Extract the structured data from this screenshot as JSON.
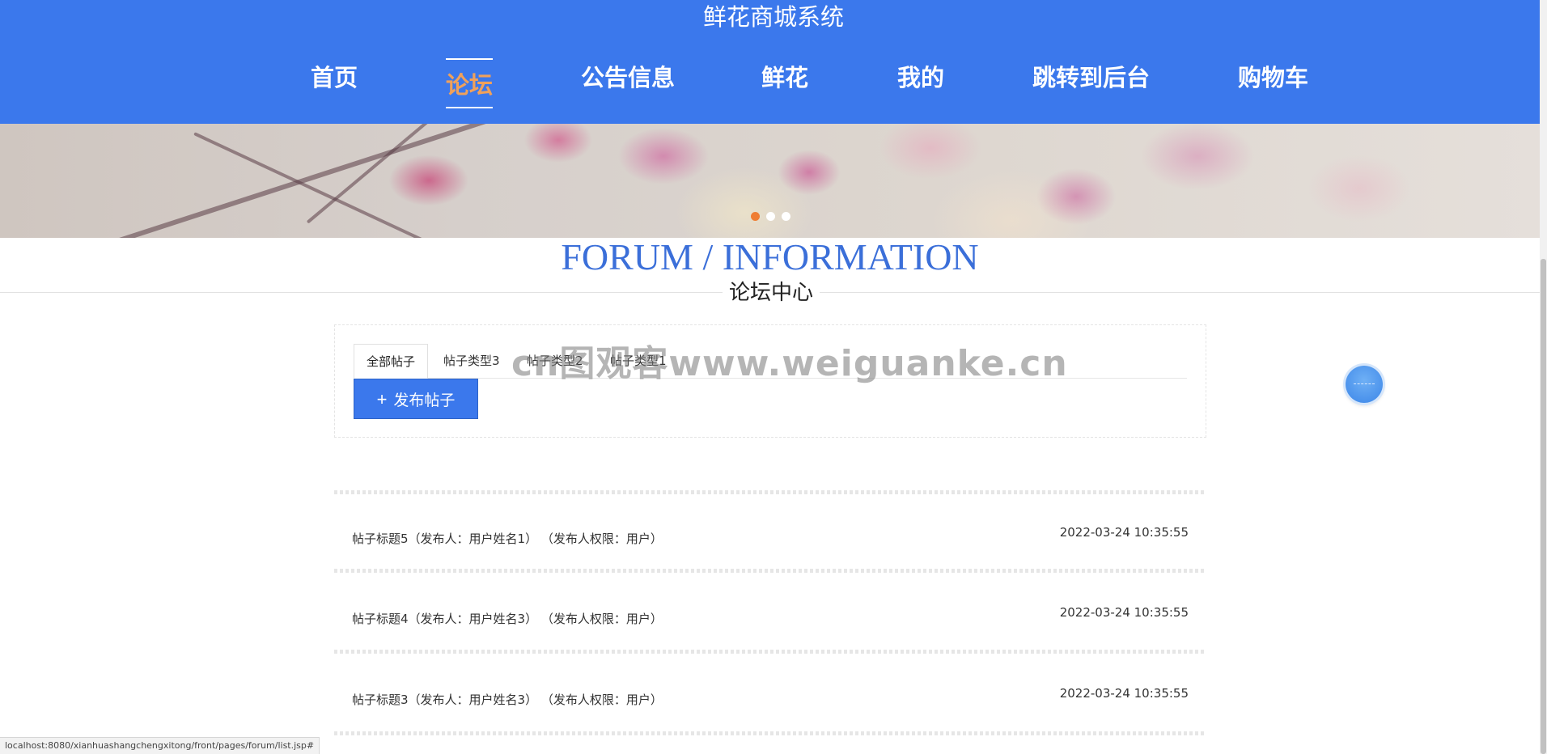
{
  "header": {
    "title": "鲜花商城系统"
  },
  "nav": {
    "items": [
      {
        "label": "首页"
      },
      {
        "label": "论坛"
      },
      {
        "label": "公告信息"
      },
      {
        "label": "鲜花"
      },
      {
        "label": "我的"
      },
      {
        "label": "跳转到后台"
      },
      {
        "label": "购物车"
      }
    ],
    "active_index": 1,
    "active_color": "#f0a15b",
    "background": "#3b78ec"
  },
  "banner": {
    "slide_count": 3,
    "active_slide": 1,
    "active_dot_color": "#ef7d33"
  },
  "section": {
    "title": "FORUM / INFORMATION",
    "subtitle": "论坛中心"
  },
  "tabs": [
    {
      "label": "全部帖子",
      "active": true
    },
    {
      "label": "帖子类型3"
    },
    {
      "label": "帖子类型2"
    },
    {
      "label": "帖子类型1"
    }
  ],
  "actions": {
    "post_button_label": "发布帖子",
    "post_button_icon": "plus-icon"
  },
  "watermark": "cn图观客www.weiguanke.cn",
  "posts": [
    {
      "title": "帖子标题5（发布人：用户姓名1） （发布人权限：用户）",
      "time": "2022-03-24 10:35:55"
    },
    {
      "title": "帖子标题4（发布人：用户姓名3） （发布人权限：用户）",
      "time": "2022-03-24 10:35:55"
    },
    {
      "title": "帖子标题3（发布人：用户姓名3） （发布人权限：用户）",
      "time": "2022-03-24 10:35:55"
    }
  ],
  "status_bar": {
    "url": "localhost:8080/xianhuashangchengxitong/front/pages/forum/list.jsp#"
  }
}
